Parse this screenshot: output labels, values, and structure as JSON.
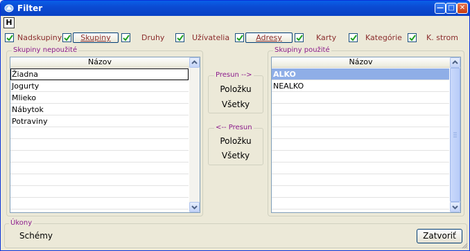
{
  "window": {
    "title": "Filter"
  },
  "toolbar": {
    "h_label": "H",
    "filters": [
      {
        "label": "Nadskupiny",
        "checked": true
      },
      {
        "label": "Skupiny",
        "checked": true,
        "button": true
      },
      {
        "label": "Druhy",
        "checked": true
      },
      {
        "label": "Užívatelia",
        "checked": true
      },
      {
        "label": "Adresy",
        "checked": true,
        "button": true
      },
      {
        "label": "Karty",
        "checked": true
      },
      {
        "label": "Kategórie",
        "checked": true
      },
      {
        "label": "K. strom",
        "checked": true
      }
    ]
  },
  "left_panel": {
    "legend": "Skupiny nepoužité",
    "column": "Názov",
    "rows": [
      "Žiadna",
      "Jogurty",
      "Mlieko",
      "Nábytok",
      "Potraviny"
    ]
  },
  "move_right": {
    "legend": "Presun -->",
    "item": "Položku",
    "all": "Všetky"
  },
  "move_left": {
    "legend": "<-- Presun",
    "item": "Položku",
    "all": "Všetky"
  },
  "right_panel": {
    "legend": "Skupiny použité",
    "column": "Názov",
    "rows": [
      "ALKO",
      "NEALKO"
    ]
  },
  "actions": {
    "legend": "Úkony",
    "schemes": "Schémy",
    "close": "Zatvoriť"
  },
  "colors": {
    "titlebar": "#0B4BD3",
    "selection": "#8FAEE7",
    "label": "#8B2D2D",
    "legend": "#8B1A8B"
  }
}
